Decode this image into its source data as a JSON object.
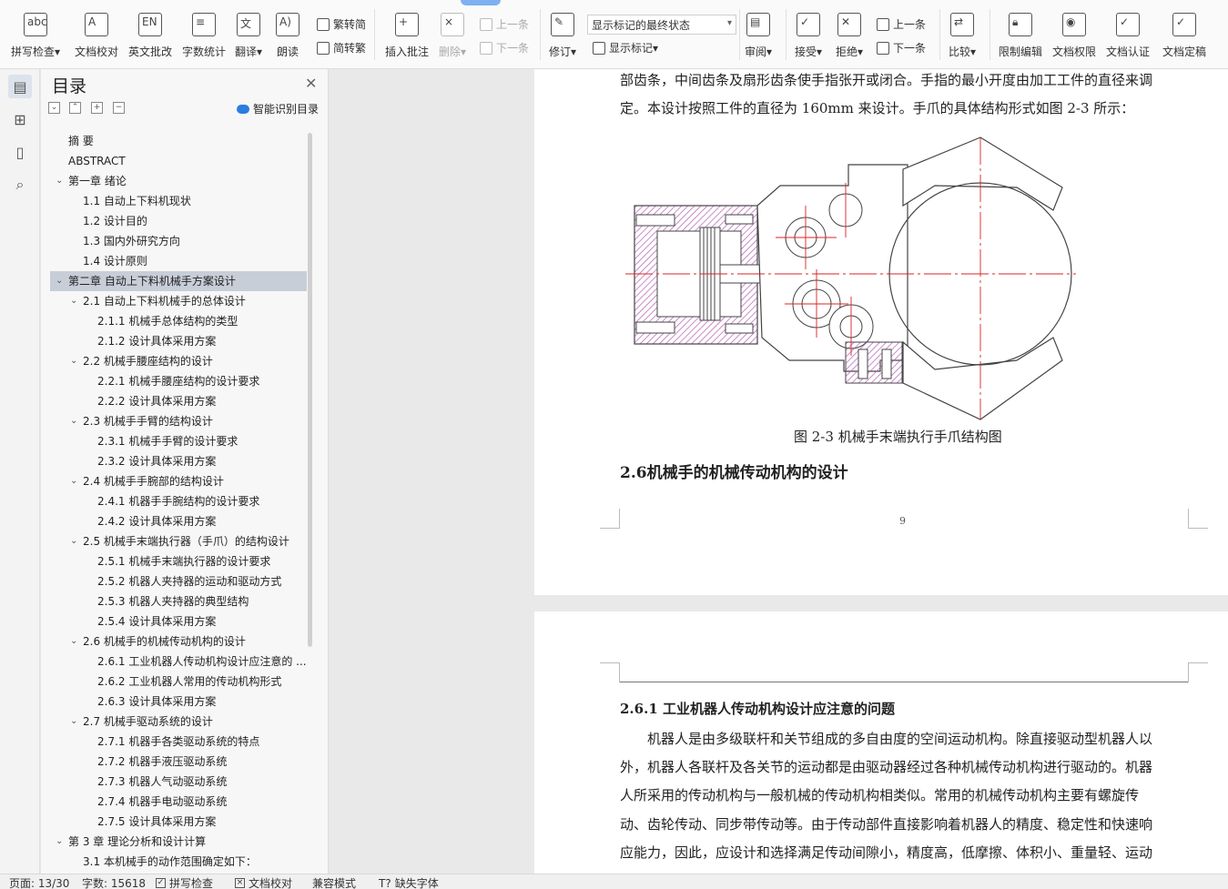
{
  "ribbon": {
    "spell_check": "拼写检查",
    "doc_proofread": "文档校对",
    "english_review": "英文批改",
    "word_count": "字数统计",
    "translate": "翻译",
    "read_aloud": "朗读",
    "trad_to_simp": "繁转简",
    "simp_to_trad": "简转繁",
    "insert_comment": "插入批注",
    "delete": "删除",
    "prev_comment": "上一条",
    "next_comment": "下一条",
    "revise": "修订",
    "display_mode": "显示标记的最终状态",
    "show_marks": "显示标记",
    "review": "审阅",
    "accept": "接受",
    "reject": "拒绝",
    "prev_change": "上一条",
    "next_change": "下一条",
    "compare": "比较",
    "restrict_edit": "限制编辑",
    "doc_permission": "文档权限",
    "doc_certify": "文档认证",
    "doc_finalize": "文档定稿"
  },
  "toc": {
    "title": "目录",
    "smart_toc": "智能识别目录",
    "items": [
      {
        "level": 0,
        "text": "摘  要",
        "chev": ""
      },
      {
        "level": 0,
        "text": "ABSTRACT",
        "chev": ""
      },
      {
        "level": 0,
        "text": "第一章  绪论",
        "chev": "⌄"
      },
      {
        "level": 1,
        "text": "1.1 自动上下料机现状",
        "chev": ""
      },
      {
        "level": 1,
        "text": "1.2 设计目的",
        "chev": ""
      },
      {
        "level": 1,
        "text": "1.3  国内外研究方向",
        "chev": ""
      },
      {
        "level": 1,
        "text": "1.4  设计原则",
        "chev": ""
      },
      {
        "level": 0,
        "text": "第二章   自动上下料机械手方案设计",
        "chev": "⌄",
        "selected": true
      },
      {
        "level": 1,
        "text": "2.1 自动上下料机械手的总体设计",
        "chev": "⌄"
      },
      {
        "level": 2,
        "text": "2.1.1  机械手总体结构的类型",
        "chev": ""
      },
      {
        "level": 2,
        "text": "2.1.2  设计具体采用方案",
        "chev": ""
      },
      {
        "level": 1,
        "text": "2.2  机械手腰座结构的设计",
        "chev": "⌄"
      },
      {
        "level": 2,
        "text": "2.2.1  机械手腰座结构的设计要求",
        "chev": ""
      },
      {
        "level": 2,
        "text": "2.2.2  设计具体采用方案",
        "chev": ""
      },
      {
        "level": 1,
        "text": "2.3  机械手手臂的结构设计",
        "chev": "⌄"
      },
      {
        "level": 2,
        "text": "2.3.1  机械手手臂的设计要求",
        "chev": ""
      },
      {
        "level": 2,
        "text": "2.3.2  设计具体采用方案",
        "chev": ""
      },
      {
        "level": 1,
        "text": "2.4  机械手手腕部的结构设计",
        "chev": "⌄"
      },
      {
        "level": 2,
        "text": "2.4.1  机器手手腕结构的设计要求",
        "chev": ""
      },
      {
        "level": 2,
        "text": "2.4.2 设计具体采用方案",
        "chev": ""
      },
      {
        "level": 1,
        "text": "2.5 机械手末端执行器（手爪）的结构设计",
        "chev": "⌄"
      },
      {
        "level": 2,
        "text": "2.5.1 机械手末端执行器的设计要求",
        "chev": ""
      },
      {
        "level": 2,
        "text": "2.5.2 机器人夹持器的运动和驱动方式",
        "chev": ""
      },
      {
        "level": 2,
        "text": "2.5.3  机器人夹持器的典型结构",
        "chev": ""
      },
      {
        "level": 2,
        "text": "2.5.4 设计具体采用方案",
        "chev": ""
      },
      {
        "level": 1,
        "text": "2.6 机械手的机械传动机构的设计",
        "chev": "⌄"
      },
      {
        "level": 2,
        "text": "2.6.1  工业机器人传动机构设计应注意的 ...",
        "chev": ""
      },
      {
        "level": 2,
        "text": "2.6.2  工业机器人常用的传动机构形式",
        "chev": ""
      },
      {
        "level": 2,
        "text": "2.6.3  设计具体采用方案",
        "chev": ""
      },
      {
        "level": 1,
        "text": "2.7 机械手驱动系统的设计",
        "chev": "⌄"
      },
      {
        "level": 2,
        "text": "2.7.1 机器手各类驱动系统的特点",
        "chev": ""
      },
      {
        "level": 2,
        "text": "2.7.2 机器手液压驱动系统",
        "chev": ""
      },
      {
        "level": 2,
        "text": "2.7.3  机器人气动驱动系统",
        "chev": ""
      },
      {
        "level": 2,
        "text": "2.7.4 机器手电动驱动系统",
        "chev": ""
      },
      {
        "level": 2,
        "text": "2.7.5 设计具体采用方案",
        "chev": ""
      },
      {
        "level": 0,
        "text": "第 3 章   理论分析和设计计算",
        "chev": "⌄"
      },
      {
        "level": 1,
        "text": "3.1 本机械手的动作范围确定如下：",
        "chev": ""
      }
    ]
  },
  "document": {
    "page1": {
      "line1": "部齿条，中间齿条及扇形齿条使手指张开或闭合。手指的最小开度由加工工件的直径来调",
      "line2": "定。本设计按照工件的直径为 160mm 来设计。手爪的具体结构形式如图 2-3 所示：",
      "caption": "图 2-3 机械手末端执行手爪结构图",
      "heading": "2.6机械手的机械传动机构的设计",
      "page_number": "9"
    },
    "page2": {
      "heading": "2.6.1 工业机器人传动机构设计应注意的问题",
      "lines": [
        "　　机器人是由多级联杆和关节组成的多自由度的空间运动机构。除直接驱动型机器人以",
        "外，机器人各联杆及各关节的运动都是由驱动器经过各种机械传动机构进行驱动的。机器",
        "人所采用的传动机构与一般机械的传动机构相类似。常用的机械传动机构主要有螺旋传",
        "动、齿轮传动、同步带传动等。由于传动部件直接影响着机器人的精度、稳定性和快速响",
        "应能力，因此，应设计和选择满足传动间隙小，精度高，低摩擦、体积小、重量轻、运动"
      ]
    }
  },
  "statusbar": {
    "page": "页面: 13/30",
    "words": "字数: 15618",
    "spell_check": "拼写检查",
    "doc_proofread": "文档校对",
    "compat_mode": "兼容模式",
    "missing_font": "缺失字体"
  },
  "colors": {
    "hatch": "#b35db3",
    "centerline": "#e02020",
    "accent": "#2a7de1"
  }
}
